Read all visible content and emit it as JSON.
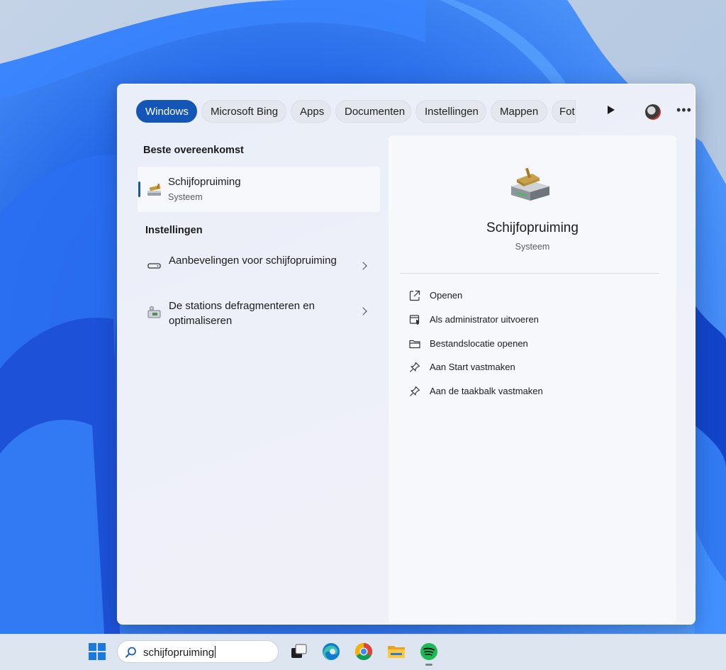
{
  "filters": {
    "chips": [
      "Windows",
      "Microsoft Bing",
      "Apps",
      "Documenten",
      "Instellingen",
      "Mappen",
      "Fot"
    ],
    "active": "Windows"
  },
  "best_match": {
    "heading": "Beste overeenkomst",
    "title": "Schijfopruiming",
    "subtitle": "Systeem",
    "icon": "disk-cleanup-icon"
  },
  "settings": {
    "heading": "Instellingen",
    "items": [
      {
        "label": "Aanbevelingen voor schijfopruiming",
        "icon": "storage-icon"
      },
      {
        "label": "De stations defragmenteren en optimaliseren",
        "icon": "defrag-icon"
      }
    ]
  },
  "detail": {
    "title": "Schijfopruiming",
    "subtitle": "Systeem",
    "actions": [
      {
        "label": "Openen",
        "icon": "open-icon"
      },
      {
        "label": "Als administrator uitvoeren",
        "icon": "shield-icon"
      },
      {
        "label": "Bestandslocatie openen",
        "icon": "folder-icon"
      },
      {
        "label": "Aan Start vastmaken",
        "icon": "pin-icon"
      },
      {
        "label": "Aan de taakbalk vastmaken",
        "icon": "pin-icon"
      }
    ]
  },
  "taskbar": {
    "search_value": "schijfopruiming",
    "apps": [
      "windows-start-icon",
      "task-view-icon",
      "edge-icon",
      "chrome-icon",
      "file-explorer-icon",
      "spotify-icon"
    ]
  },
  "colors": {
    "accent": "#1456b8",
    "wallpaper_blue": "#1a5fe6"
  }
}
